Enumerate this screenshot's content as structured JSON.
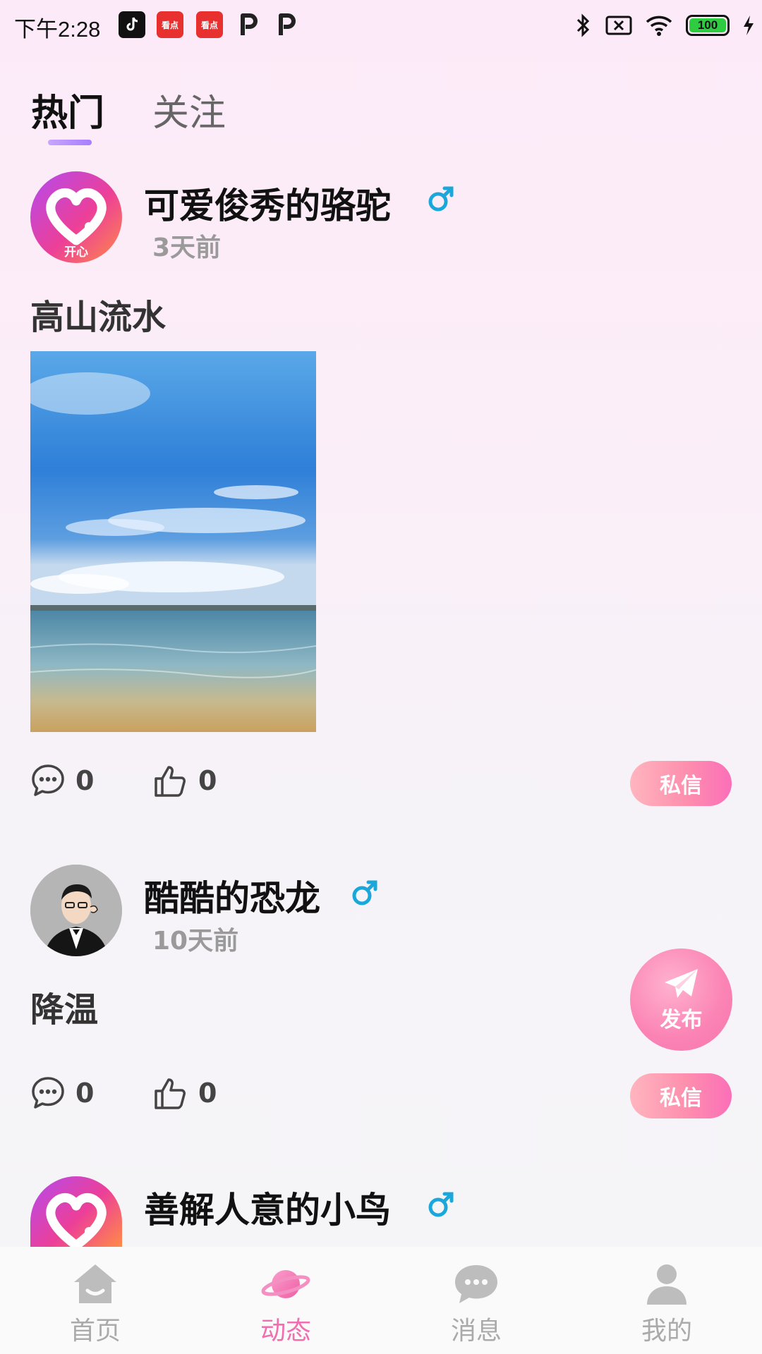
{
  "status_bar": {
    "time": "下午2:28",
    "battery": "100",
    "app_icons": [
      "tiktok-icon",
      "kandian-icon",
      "kandian-icon",
      "p-app-icon",
      "p-app-icon"
    ],
    "app_icon_text": "看点"
  },
  "tabs": [
    {
      "label": "热门",
      "active": true
    },
    {
      "label": "关注",
      "active": false
    }
  ],
  "posts": [
    {
      "username": "可爱俊秀的骆驼",
      "gender": "male",
      "time": "3天前",
      "text": "高山流水",
      "has_image": true,
      "comments": "0",
      "likes": "0",
      "dm_label": "私信",
      "avatar_text": "开心"
    },
    {
      "username": "酷酷的恐龙",
      "gender": "male",
      "time": "10天前",
      "text": "降温",
      "has_image": false,
      "comments": "0",
      "likes": "0",
      "dm_label": "私信"
    },
    {
      "username": "善解人意的小鸟",
      "gender": "male"
    }
  ],
  "fab": {
    "label": "发布",
    "icon": "paper-plane-icon"
  },
  "bottom_nav": [
    {
      "label": "首页",
      "icon": "home-icon",
      "active": false
    },
    {
      "label": "动态",
      "icon": "planet-icon",
      "active": true
    },
    {
      "label": "消息",
      "icon": "chat-bubble-icon",
      "active": false
    },
    {
      "label": "我的",
      "icon": "user-icon",
      "active": false
    }
  ],
  "colors": {
    "accent_pink": "#f06fb0",
    "male_blue": "#1aa7d9",
    "tab_indicator": "#b48cff",
    "inactive": "#aaaaaa"
  }
}
